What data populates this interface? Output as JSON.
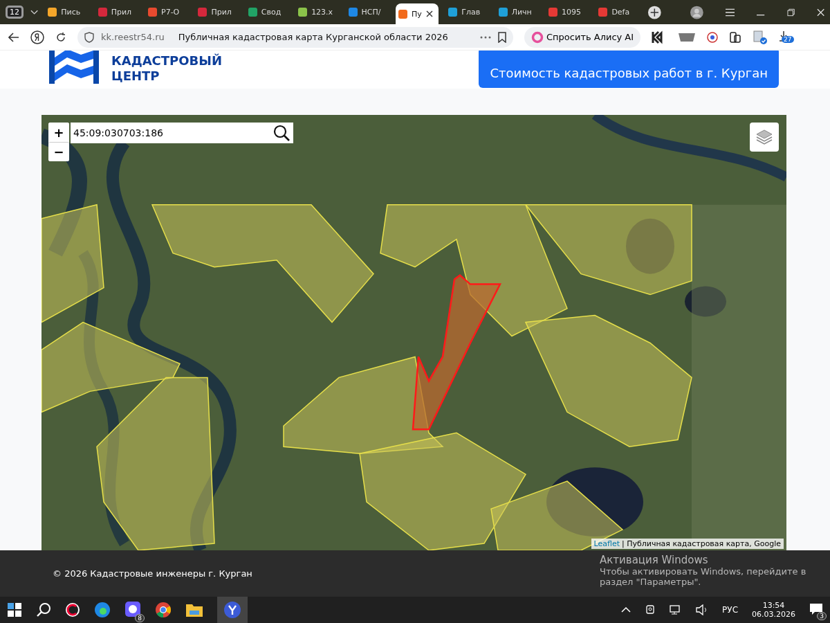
{
  "browser": {
    "tab_count": "12",
    "tabs": [
      {
        "title": "Пись",
        "selected": false,
        "color": "#f4a62a"
      },
      {
        "title": "Прил",
        "selected": false,
        "color": "#d4283c"
      },
      {
        "title": "Р7-О",
        "selected": false,
        "color": "#e84a2f"
      },
      {
        "title": "Прил",
        "selected": false,
        "color": "#d4283c"
      },
      {
        "title": "Свод",
        "selected": false,
        "color": "#21a366"
      },
      {
        "title": "123.x",
        "selected": false,
        "color": "#8bc34a"
      },
      {
        "title": "НСП/",
        "selected": false,
        "color": "#1e88e5"
      },
      {
        "title": "Пу",
        "selected": true,
        "color": "#f26b1d"
      },
      {
        "title": "Глав",
        "selected": false,
        "color": "#1fa0d8"
      },
      {
        "title": "Личн",
        "selected": false,
        "color": "#1fa0d8"
      },
      {
        "title": "1095",
        "selected": false,
        "color": "#e53935"
      },
      {
        "title": "Defa",
        "selected": false,
        "color": "#e53935"
      }
    ],
    "url": "kk.reestr54.ru",
    "page_title": "Публичная кадастровая карта Курганской области 2026",
    "alice_button": "Спросить Алису AI",
    "downloads_badge": "27"
  },
  "header": {
    "logo_line_1": "КАДАСТРОВЫЙ",
    "logo_line_2": "ЦЕНТР",
    "cta_button": "Стоимость кадастровых работ в г. Курган"
  },
  "map": {
    "zoom_in": "+",
    "zoom_out": "−",
    "search_value": "45:09:030703:186",
    "attribution_link": "Leaflet",
    "attribution_text": "| Публичная кадастровая карта, Google"
  },
  "footer": {
    "copyright": "© 2026 Кадастровые инженеры г. Курган"
  },
  "activation_notice": {
    "title": "Активация Windows",
    "text": "Чтобы активировать Windows, перейдите в раздел \"Параметры\"."
  },
  "taskbar": {
    "language": "РУС",
    "time": "13:54",
    "date": "06.03.2026",
    "notification_count": "3",
    "messenger_badge": "8"
  }
}
